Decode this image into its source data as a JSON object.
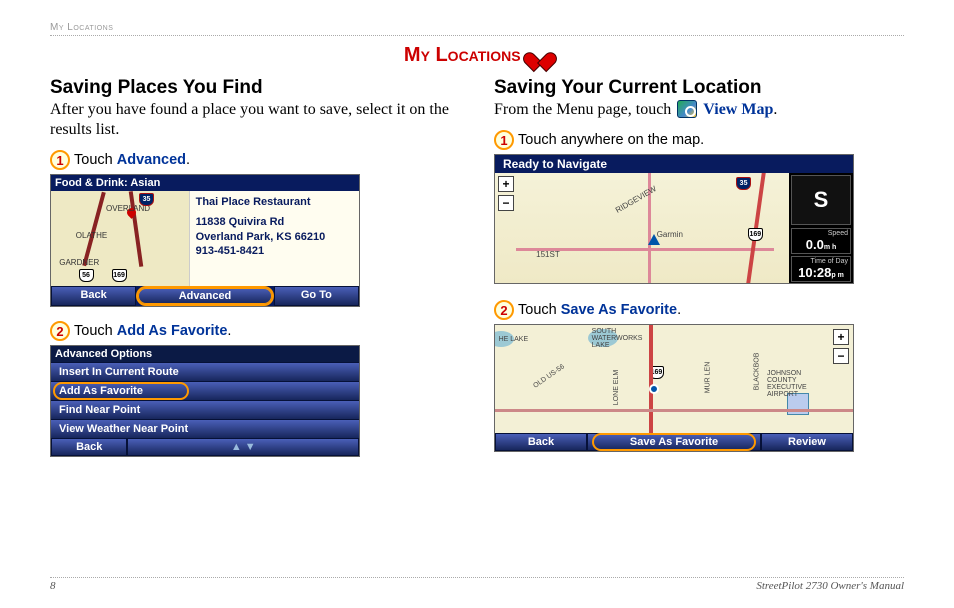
{
  "topbar_label": "My Locations",
  "main_title": "My Locations",
  "left": {
    "section_title": "Saving Places You Find",
    "intro": "After you have found a place you want to save, select it on the results list.",
    "step1_prefix": "Touch ",
    "step1_link": "Advanced",
    "step1_suffix": ".",
    "ss1": {
      "header": "Food & Drink: Asian",
      "poi_name": "Thai Place Restaurant",
      "poi_addr1": "11838 Quivira Rd",
      "poi_addr2": "Overland Park, KS 66210",
      "poi_phone": "913-451-8421",
      "city1": "OVERLAND",
      "city2": "OLATHE",
      "city3": "GARDNER",
      "sh1": "35",
      "sh2": "56",
      "sh3": "169",
      "btn_back": "Back",
      "btn_adv": "Advanced",
      "btn_goto": "Go To"
    },
    "step2_prefix": "Touch ",
    "step2_link": "Add As Favorite",
    "step2_suffix": ".",
    "ss2": {
      "header": "Advanced Options",
      "item1": "Insert In Current Route",
      "item2": "Add As Favorite",
      "item3": "Find Near Point",
      "item4": "View Weather Near Point",
      "btn_back": "Back",
      "arrows": "▲    ▼"
    }
  },
  "right": {
    "section_title": "Saving Your Current Location",
    "intro_prefix": "From the Menu page, touch ",
    "intro_link": "View Map",
    "intro_suffix": ".",
    "step1_text": "Touch anywhere on the map.",
    "nav": {
      "title": "Ready to Navigate",
      "dir": "S",
      "speed_label": "Speed",
      "speed_value": "0.0",
      "speed_unit": "m h",
      "time_label": "Time of Day",
      "time_value": "10:28",
      "time_unit": "p m",
      "road1": "151ST",
      "road2": "RIDGEVIEW",
      "road3": "Garmin",
      "sh1": "35",
      "sh2": "169",
      "zoom_in": "+",
      "zoom_out": "−"
    },
    "step2_prefix": "Touch ",
    "step2_link": "Save As Favorite",
    "step2_suffix": ".",
    "save": {
      "btn_back": "Back",
      "btn_save": "Save As Favorite",
      "btn_review": "Review",
      "lbl1": "SOUTH WATERWORKS LAKE",
      "lbl2": "MUR LEN",
      "lbl3": "BLACKBOB",
      "lbl4": "JOHNSON COUNTY EXECUTIVE AIRPORT",
      "lbl5": "HE LAKE",
      "lbl6": "OLD US-56",
      "lbl7": "LONE ELM",
      "sh1": "169",
      "zoom_in": "+",
      "zoom_out": "−"
    }
  },
  "footer_page": "8",
  "footer_manual": "StreetPilot 2730 Owner's Manual"
}
